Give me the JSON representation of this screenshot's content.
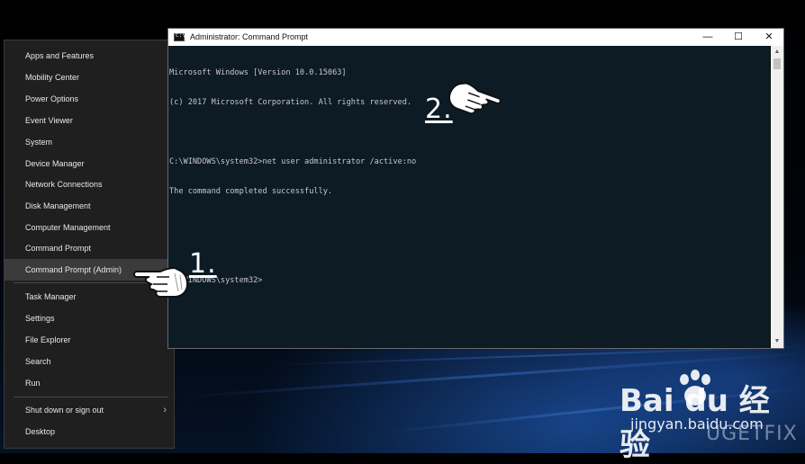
{
  "winx_menu": {
    "items": [
      {
        "label": "Apps and Features"
      },
      {
        "label": "Mobility Center"
      },
      {
        "label": "Power Options"
      },
      {
        "label": "Event Viewer"
      },
      {
        "label": "System"
      },
      {
        "label": "Device Manager"
      },
      {
        "label": "Network Connections"
      },
      {
        "label": "Disk Management"
      },
      {
        "label": "Computer Management"
      },
      {
        "label": "Command Prompt"
      },
      {
        "label": "Command Prompt (Admin)"
      },
      {
        "label": "Task Manager"
      },
      {
        "label": "Settings"
      },
      {
        "label": "File Explorer"
      },
      {
        "label": "Search"
      },
      {
        "label": "Run"
      },
      {
        "label": "Shut down or sign out"
      },
      {
        "label": "Desktop"
      }
    ],
    "highlighted": "Command Prompt (Admin)"
  },
  "cmd_window": {
    "title": "Administrator: Command Prompt",
    "icon_glyph": "C:\\",
    "controls": {
      "minimize": "—",
      "maximize": "☐",
      "close": "✕"
    },
    "console_lines": [
      "Microsoft Windows [Version 10.0.15063]",
      "(c) 2017 Microsoft Corporation. All rights reserved.",
      "",
      "C:\\WINDOWS\\system32>net user administrator /active:no",
      "The command completed successfully.",
      "",
      "",
      "C:\\WINDOWS\\system32>"
    ]
  },
  "steps": {
    "step1": "1.",
    "step2": "2."
  },
  "watermarks": {
    "baidu_logo": "Bai du 经验",
    "baidu_site": "jingyan.baidu.com",
    "ugetfix": "UGETFIX"
  },
  "colors": {
    "menu_bg": "#1f1f1f",
    "menu_highlight": "#3b3b3b",
    "console_bg": "#0c1b24",
    "console_text": "#c8c8c8"
  }
}
